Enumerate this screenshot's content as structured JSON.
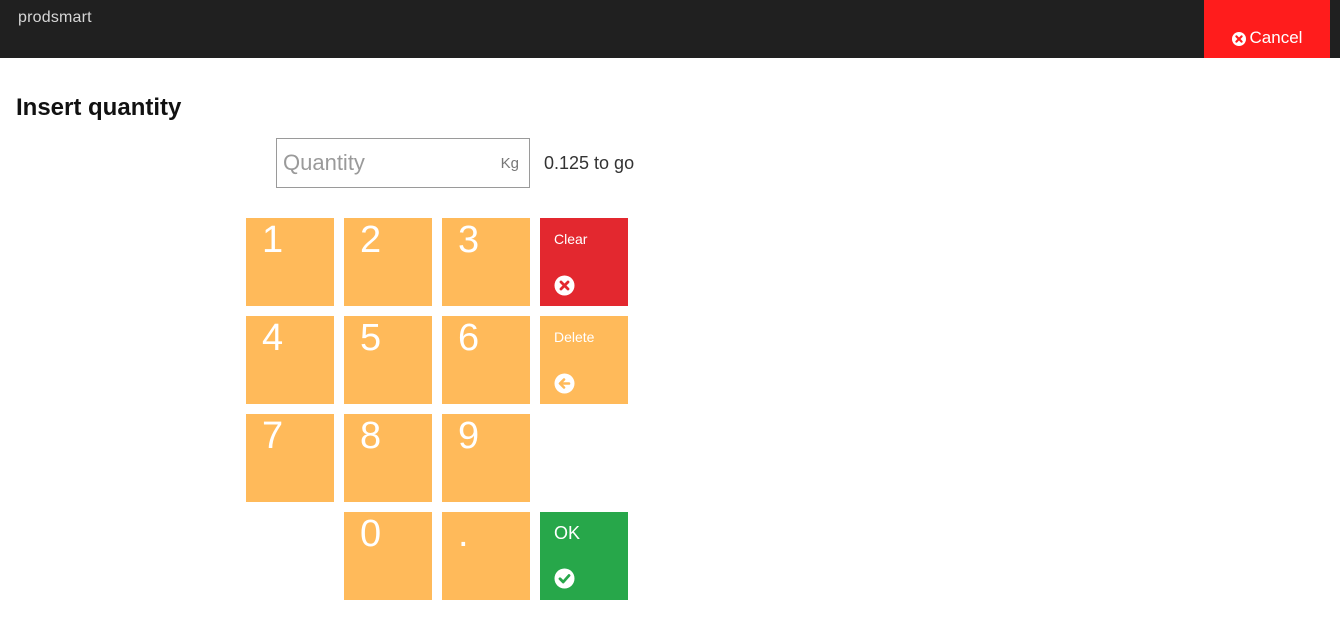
{
  "header": {
    "logo_text": "prodsmart",
    "cancel_label": "Cancel",
    "cancel_icon": "times-circle-icon",
    "background": "#202020",
    "cancel_color": "#ff1c1c"
  },
  "page": {
    "title": "Insert quantity"
  },
  "quantity": {
    "placeholder": "Quantity",
    "value": "",
    "unit": "Kg",
    "remaining": "0.125 to go"
  },
  "keypad": {
    "keys": [
      "1",
      "2",
      "3",
      "4",
      "5",
      "6",
      "7",
      "8",
      "9",
      "0",
      "."
    ],
    "key_color": "#ffba5a",
    "clear": {
      "label": "Clear",
      "icon": "times-circle-icon",
      "color": "#e3282f"
    },
    "delete": {
      "label": "Delete",
      "icon": "arrow-left-circle-icon",
      "color": "#ffba5a"
    },
    "ok": {
      "label": "OK",
      "icon": "check-circle-icon",
      "color": "#27a74a"
    }
  }
}
